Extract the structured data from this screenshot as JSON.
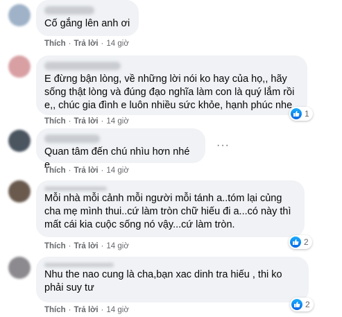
{
  "comments": [
    {
      "lines": [
        "Cố gắng lên anh ơi"
      ],
      "like_label": "Thích",
      "reply_label": "Trả lời",
      "time": "14 giờ",
      "reactions": null,
      "avatar_color": "#9fb2c8"
    },
    {
      "lines": [
        "E đừng bận lòng, về những lời nói ko hay của họ,, hãy",
        "sống thật lòng và đúng đạo nghĩa làm con là quý lắm rồi",
        "e,, chúc gia đình e luôn nhiều sức khỏe, hạnh phúc nhe"
      ],
      "like_label": "Thích",
      "reply_label": "Trả lời",
      "time": "14 giờ",
      "reactions": "1",
      "avatar_color": "#d9a0a4"
    },
    {
      "lines": [
        "Quan tâm đến chú nhìu hơn nhé e"
      ],
      "like_label": "Thích",
      "reply_label": "Trả lời",
      "time": "14 giờ",
      "reactions": null,
      "avatar_color": "#4a5560"
    },
    {
      "lines": [
        "Mỗi nhà mỗi cảnh mỗi người mỗi tánh a..tóm lại củng",
        "cha mẹ mình thui..cứ làm tròn chữ hiếu đi a...có này thì",
        "mất cái kia cuộc sống nó vậy...cứ làm tròn."
      ],
      "like_label": "Thích",
      "reply_label": "Trả lời",
      "time": "14 giờ",
      "reactions": "2",
      "avatar_color": "#6a5a4e"
    },
    {
      "lines": [
        "Nhu the nao cung là cha,bạn xac dinh tra hiếu , thi ko",
        "phải suy tư"
      ],
      "like_label": "Thích",
      "reply_label": "Trả lời",
      "time": "14 giờ",
      "reactions": "2",
      "avatar_color": "#8d8a8f"
    }
  ],
  "more_options_icon": "more-horizontal-icon",
  "reaction_icon": "like-icon",
  "colors": {
    "bubble": "#f0f2f5",
    "meta": "#65676b",
    "like_blue": "#0a66e4"
  }
}
